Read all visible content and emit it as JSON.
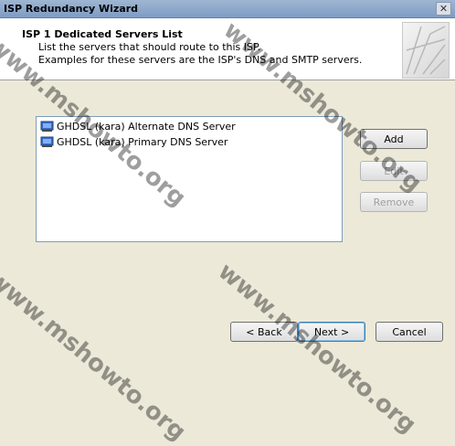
{
  "window": {
    "title": "ISP Redundancy Wizard",
    "close_glyph": "✕"
  },
  "header": {
    "title": "ISP 1 Dedicated Servers List",
    "line1": "List the servers that should route to this ISP.",
    "line2": "Examples for these servers are the ISP's DNS and SMTP servers."
  },
  "servers": [
    {
      "label": "GHDSL (kara) Alternate DNS Server",
      "icon": "server-icon"
    },
    {
      "label": "GHDSL (kara) Primary DNS Server",
      "icon": "server-icon"
    }
  ],
  "side_buttons": {
    "add": "Add",
    "edit": "Edit",
    "remove": "Remove"
  },
  "footer_buttons": {
    "back": "< Back",
    "next": "Next >",
    "cancel": "Cancel"
  },
  "watermark": "www.mshowto.org",
  "colors": {
    "title_bar": "#8eaacf",
    "dialog_bg": "#ece9d8",
    "list_border": "#7f9db9",
    "default_button": "#3c7fb1"
  }
}
